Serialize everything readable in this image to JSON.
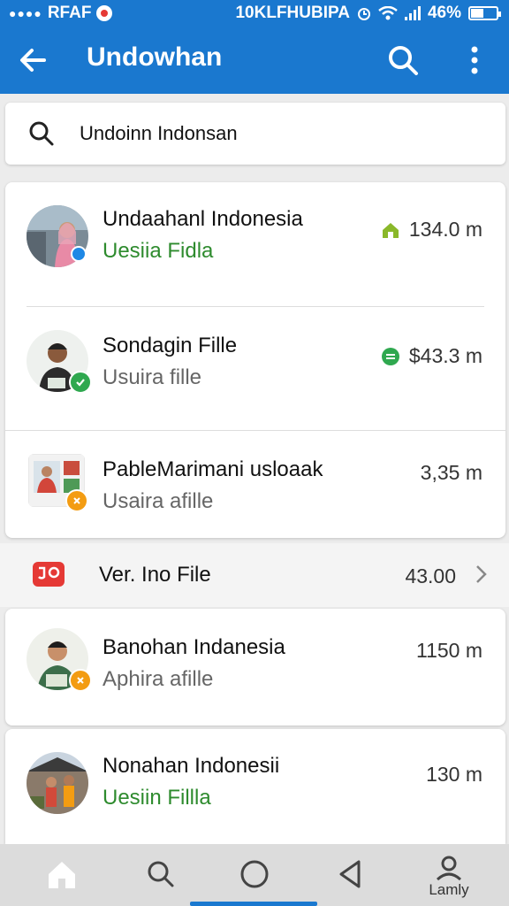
{
  "status_bar": {
    "dots": "●●●●",
    "carrier": "RFAF",
    "center": "10KLFHUBIPA",
    "battery": "46%",
    "battery_level": 0.46
  },
  "app_bar": {
    "title": "Undowhan",
    "back_icon": "arrow-left-icon",
    "search_icon": "search-icon",
    "more_icon": "more-vertical-icon"
  },
  "search": {
    "value": "Undoinn Indonsan",
    "icon": "search-icon"
  },
  "group1": {
    "items": [
      {
        "name": "Undaahanl Indonesia",
        "sub": "Uesiia Fidla",
        "sub_color": "green",
        "meta": "134.0 m",
        "meta_icon": "home-icon",
        "meta_icon_color": "#8ab82a",
        "badge_color": "#1e88e5"
      },
      {
        "name": "Sondagin Fille",
        "sub": "Usuira fille",
        "sub_color": "gray",
        "meta": "$43.3 m",
        "meta_icon": "green-circle-icon",
        "meta_icon_color": "#2fa84f",
        "badge_color": "#2fa84f"
      },
      {
        "name": "PableMarimani usloaak",
        "sub": "Usaira afille",
        "sub_color": "gray",
        "meta": "3,35 m",
        "badge_color": "#f39c12"
      }
    ]
  },
  "flat_row": {
    "name": "Ver. Ino File",
    "meta": "43.00",
    "icon": "video-file-icon",
    "icon_color": "#e53935"
  },
  "card4": {
    "name": "Banohan Indanesia",
    "sub": "Aphira afille",
    "sub_color": "gray",
    "meta": "1150 m",
    "badge_color": "#f39c12"
  },
  "card5": {
    "name": "Nonahan Indonesii",
    "sub": "Uesiin Fillla",
    "sub_color": "green",
    "meta": "130 m"
  },
  "bottom_nav": {
    "items": [
      "home-icon",
      "search-icon",
      "circle-icon",
      "back-triangle-icon",
      "profile-icon"
    ],
    "profile_label": "Lamly",
    "accent": "#1a78cf"
  },
  "colors": {
    "primary": "#1a78cf",
    "green_text": "#2e8b2e"
  }
}
